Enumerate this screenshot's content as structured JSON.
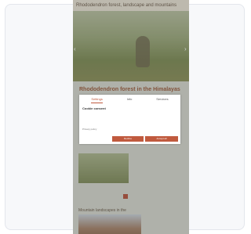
{
  "site": {
    "top_bar_text": "Rhododendron forest, landscape and mountains",
    "page_heading": "Rhododendron forest in the Himalayas",
    "page_subtext": "",
    "thumb_caption": "",
    "section_heading": "Mountain landscapes in the"
  },
  "cookie_dialog": {
    "tabs": [
      "Settings",
      "Info",
      "Services"
    ],
    "title": "Cookie consent",
    "body": "",
    "link_text": "Privacy policy",
    "deny_label": "Decline",
    "allow_label": "Accept all"
  },
  "colors": {
    "accent": "#c05a3e",
    "card_bg": "#f7f8fa"
  }
}
